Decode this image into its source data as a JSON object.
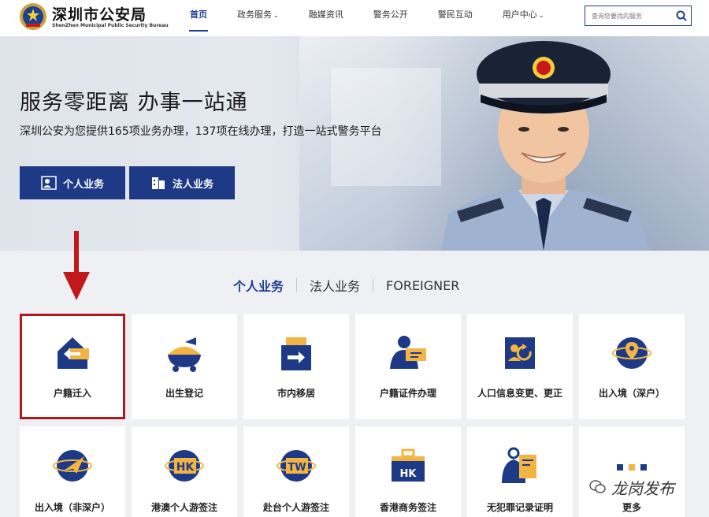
{
  "header": {
    "brand_name": "深圳市公安局",
    "brand_sub": "ShenZhen Municipal Public Security Bureau",
    "nav": [
      {
        "label": "首页",
        "active": true,
        "has_dropdown": false
      },
      {
        "label": "政务服务",
        "active": false,
        "has_dropdown": true
      },
      {
        "label": "融媒资讯",
        "active": false,
        "has_dropdown": false
      },
      {
        "label": "警务公开",
        "active": false,
        "has_dropdown": false
      },
      {
        "label": "警民互动",
        "active": false,
        "has_dropdown": false
      },
      {
        "label": "用户中心",
        "active": false,
        "has_dropdown": true
      }
    ],
    "caret": "⌄",
    "search": {
      "placeholder": "查询您要找的服务"
    }
  },
  "hero": {
    "title": "服务零距离 办事一站通",
    "subtitle": "深圳公安为您提供165项业务办理，137项在线办理，打造一站式警务平台",
    "buttons": {
      "personal": "个人业务",
      "legal": "法人业务"
    }
  },
  "tabs": [
    {
      "label": "个人业务",
      "active": true
    },
    {
      "label": "法人业务",
      "active": false
    },
    {
      "label": "FOREIGNER",
      "active": false
    }
  ],
  "services_row1": [
    {
      "label": "户籍迁入",
      "icon": "house-arrow-icon"
    },
    {
      "label": "出生登记",
      "icon": "cradle-icon"
    },
    {
      "label": "市内移居",
      "icon": "move-arrow-icon"
    },
    {
      "label": "户籍证件办理",
      "icon": "person-card-icon"
    },
    {
      "label": "人口信息变更、更正",
      "icon": "info-change-icon"
    },
    {
      "label": "出入境（深户）",
      "icon": "globe-pin-icon"
    }
  ],
  "services_row2": [
    {
      "label": "出入境（非深户）",
      "icon": "globe-plane-icon"
    },
    {
      "label": "港澳个人游签注",
      "icon": "hk-globe-icon"
    },
    {
      "label": "赴台个人游签注",
      "icon": "tw-globe-icon"
    },
    {
      "label": "香港商务签注",
      "icon": "hk-briefcase-icon"
    },
    {
      "label": "无犯罪记录证明",
      "icon": "certificate-icon"
    },
    {
      "label": "更多",
      "icon": "more-dots-icon"
    }
  ],
  "watermark": "龙岗发布",
  "colors": {
    "primary": "#1e3a86",
    "accent": "#f2b544",
    "highlight": "#b0181b"
  }
}
